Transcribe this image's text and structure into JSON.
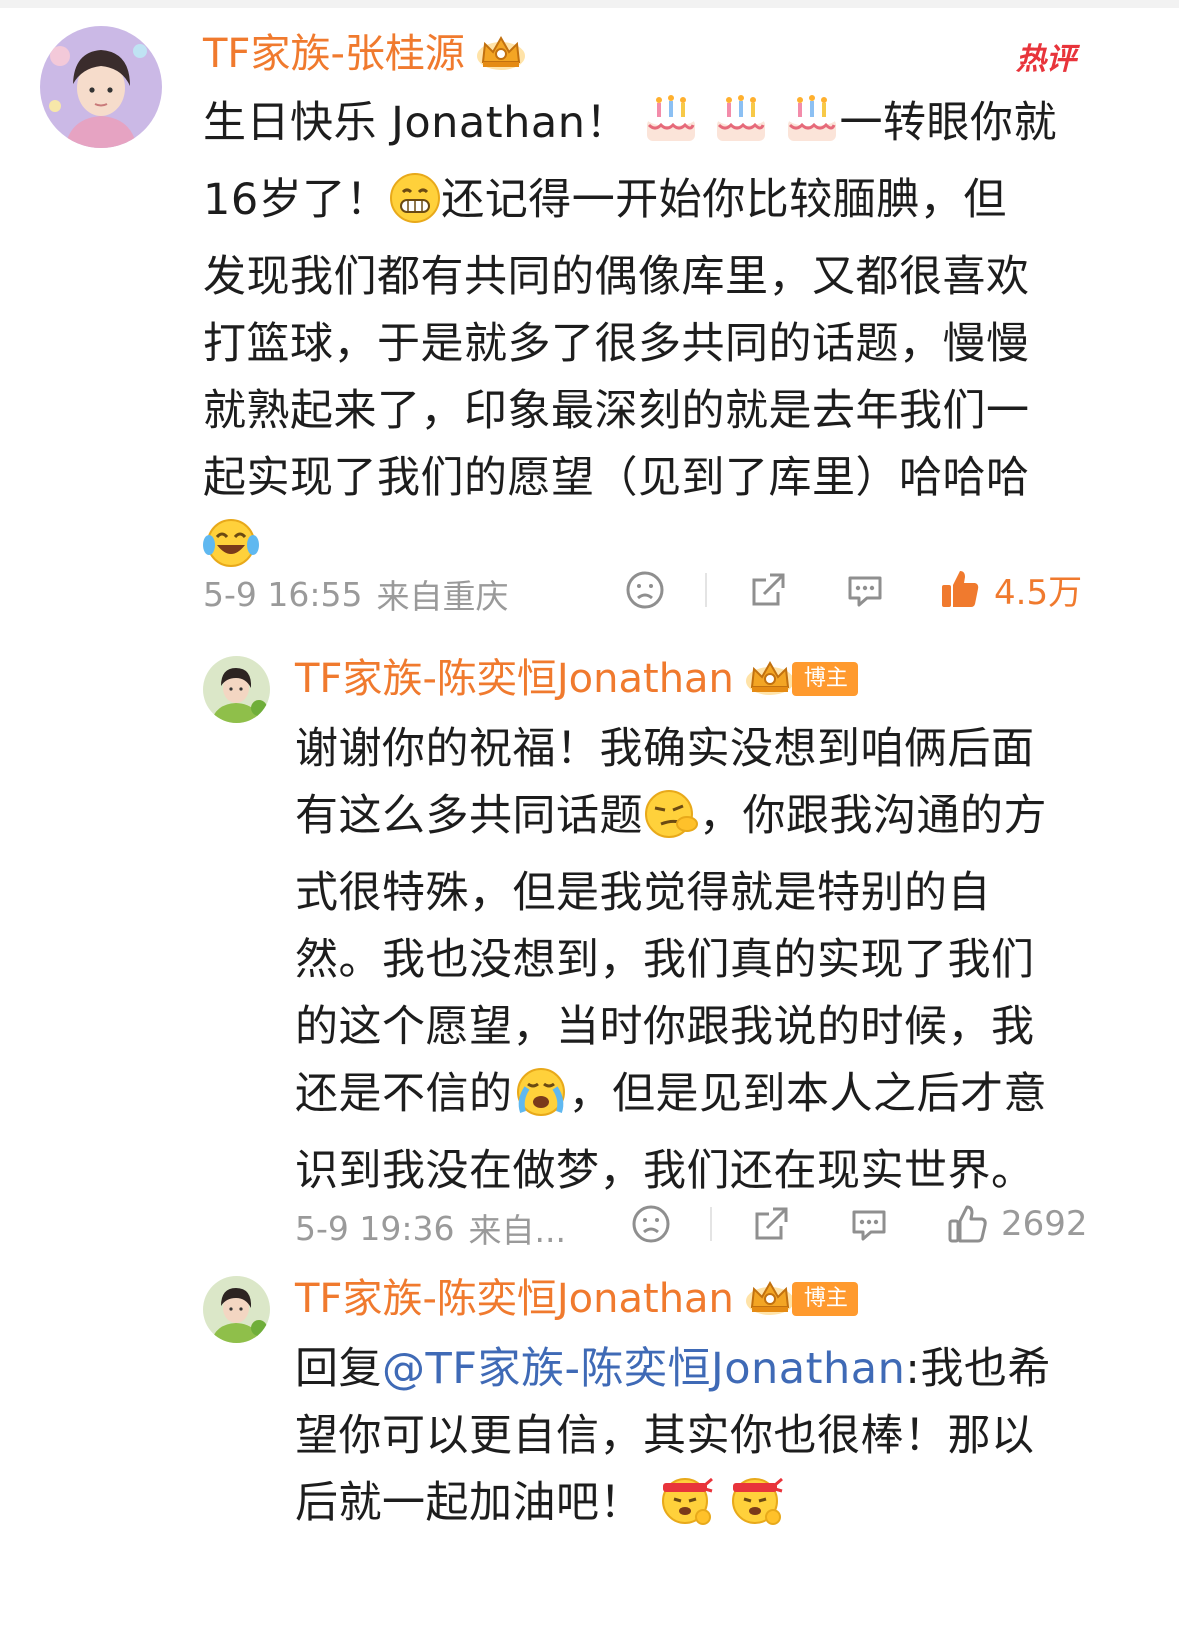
{
  "comment1": {
    "username": "TF家族-张桂源",
    "hot_tag": "热评",
    "lines": [
      [
        "生日快乐 Jonathan！ ",
        "cake",
        " ",
        "cake",
        " ",
        "cake",
        "一转眼你就"
      ],
      [
        "16岁了！",
        "grin",
        "还记得一开始你比较腼腆，但"
      ],
      [
        "发现我们都有共同的偶像库里，又都很喜欢"
      ],
      [
        "打篮球，于是就多了很多共同的话题，慢慢"
      ],
      [
        "就熟起来了，印象最深刻的就是去年我们一"
      ],
      [
        "起实现了我们的愿望（见到了库里）哈哈哈"
      ],
      [
        "laugh"
      ]
    ],
    "time": "5-9 16:55",
    "location": "来自重庆",
    "likes": "4.5万"
  },
  "reply1": {
    "username": "TF家族-陈奕恒Jonathan",
    "badge": "博主",
    "lines": [
      [
        "谢谢你的祝福！我确实没想到咱俩后面"
      ],
      [
        "有这么多共同话题",
        "smirk",
        "，你跟我沟通的方"
      ],
      [
        "式很特殊，但是我觉得就是特别的自"
      ],
      [
        "然。我也没想到，我们真的实现了我们"
      ],
      [
        "的这个愿望，当时你跟我说的时候，我"
      ],
      [
        "还是不信的",
        "cry",
        "，但是见到本人之后才意"
      ],
      [
        "识到我没在做梦，我们还在现实世界。"
      ]
    ],
    "time": "5-9 19:36",
    "location": "来自...",
    "likes": "2692"
  },
  "reply2": {
    "username": "TF家族-陈奕恒Jonathan",
    "badge": "博主",
    "reply_prefix": "回复",
    "mention": "@TF家族-陈奕恒Jonathan",
    "line1_rest": ":我也希",
    "line2": "望你可以更自信，其实你也很棒！那以",
    "line3": "后就一起加油吧！",
    "line3_emojis": [
      "fighting",
      "fighting"
    ]
  },
  "icons": {
    "dislike": "dislike-face-icon",
    "share": "share-icon",
    "comment": "comment-bubble-icon",
    "like": "thumbs-up-icon",
    "crown": "crown-badge-icon"
  },
  "colors": {
    "username": "#f07a2e",
    "hot_tag": "#e8343b",
    "mention": "#3f6ab6",
    "meta": "#9a9a9a",
    "badge": "#ff9a2e"
  }
}
